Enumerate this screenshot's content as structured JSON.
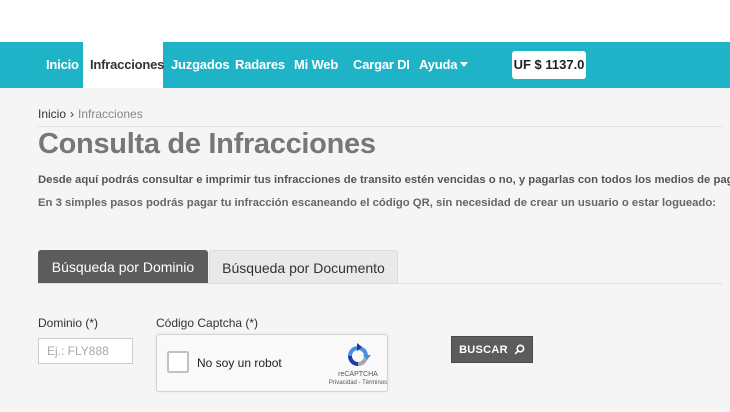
{
  "nav": {
    "items": [
      {
        "label": "Inicio"
      },
      {
        "label": "Infracciones",
        "active": true
      },
      {
        "label": "Juzgados"
      },
      {
        "label": "Radares"
      },
      {
        "label": "Mi Web"
      },
      {
        "label": "Cargar DI"
      },
      {
        "label": "Ayuda",
        "has_dropdown": true
      }
    ],
    "uf_badge": "UF $ 1137.0"
  },
  "breadcrumb": {
    "home": "Inicio",
    "separator": "›",
    "current": "Infracciones"
  },
  "page": {
    "title": "Consulta de Infracciones",
    "intro_1": "Desde aquí podrás consultar e imprimir tus infracciones de transito estén vencidas o no, y pagarlas con todos los medios de pago.",
    "intro_2": "En 3 simples pasos podrás pagar tu infracción escaneando el código QR, sin necesidad de crear un usuario o estar logueado:"
  },
  "tabs": [
    {
      "label": "Búsqueda por Dominio",
      "active": true
    },
    {
      "label": "Búsqueda por Documento",
      "active": false
    }
  ],
  "form": {
    "dominio_label": "Dominio (*)",
    "dominio_placeholder": "Ej.: FLY888",
    "dominio_value": "",
    "captcha_label": "Código Captcha (*)",
    "captcha_text": "No soy un robot",
    "captcha_brand": "reCAPTCHA",
    "captcha_terms": "Privacidad - Términos",
    "search_button": "BUSCAR"
  },
  "colors": {
    "navbar": "#1fb3c8",
    "active_tab": "#5c5c5c",
    "button": "#5c5c5c"
  },
  "icons": {
    "dropdown": "caret-down-icon",
    "search": "search-icon",
    "recaptcha": "recaptcha-logo-icon"
  }
}
